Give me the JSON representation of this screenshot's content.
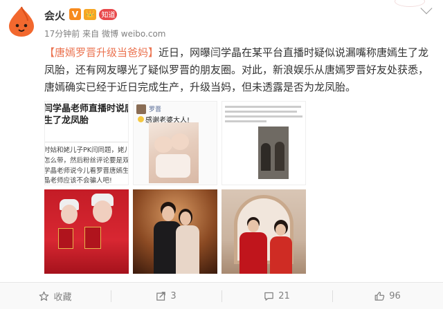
{
  "user": {
    "name": "会火",
    "verified": "V",
    "level_badge": "👑",
    "member_badge": "知道"
  },
  "meta": {
    "time": "17分钟前",
    "from_prefix": "来自",
    "source": "微博 weibo.com"
  },
  "post": {
    "topic": "【唐嫣罗晋升级当爸妈】",
    "body": "近日，网曝闫学晶在某平台直播时疑似说漏嘴称唐嫣生了龙凤胎，还有网友曝光了疑似罗晋的朋友圈。对此，新浪娱乐从唐嫣罗晋好友处获悉，唐嫣确实已经于近日完成生产，升级当妈，但未透露是否为龙凤胎。"
  },
  "images": {
    "img1": {
      "headline_1": "闫学晶老师直播时说唐",
      "headline_2": "生了龙凤胎",
      "line_1": "时姑和姥儿子PK闫同题，姥儿姥妇问",
      "line_2": "怎么带，然后粉丝评论要是双胞胎咋",
      "line_3": "学晶老师说今儿看罗晋唐嫣生了龙凤",
      "line_4": "晶老师应该不会骗人吧!"
    },
    "img2": {
      "poster_name": "罗晋",
      "message": "感谢老婆大人!"
    }
  },
  "footer": {
    "favorite_label": "收藏",
    "repost_count": "3",
    "comment_count": "21",
    "like_count": "96"
  },
  "colors": {
    "accent": "#eb7350",
    "meta_gray": "#808080",
    "verified_orange": "#f78a1d",
    "member_red": "#e8484b"
  }
}
